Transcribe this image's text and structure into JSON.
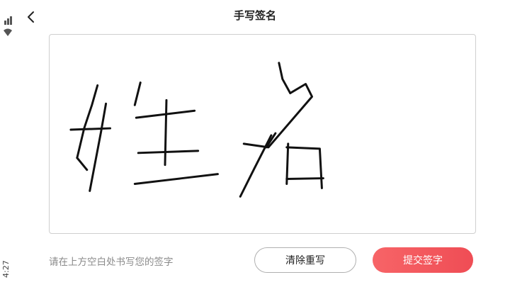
{
  "header": {
    "title": "手写签名",
    "back_icon": "chevron-left-icon"
  },
  "status_bar": {
    "time": "4:27"
  },
  "signature": {
    "written_text": "姓名"
  },
  "footer": {
    "hint": "请在上方空白处书写您的签字",
    "clear_label": "清除重写",
    "submit_label": "提交签字"
  },
  "colors": {
    "accent": "#f25a5e",
    "ink": "#111111",
    "border": "#cfcfcf"
  }
}
